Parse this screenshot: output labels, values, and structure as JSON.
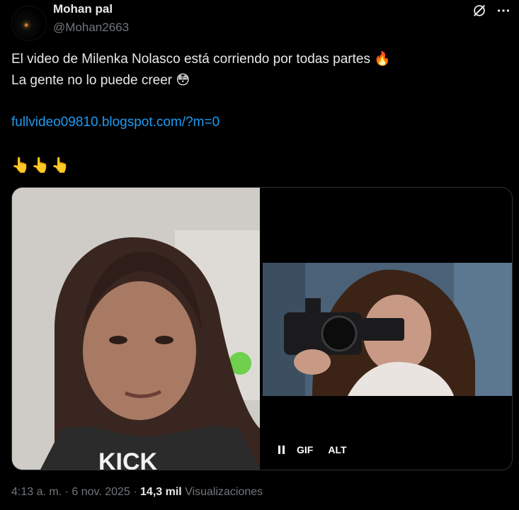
{
  "tweet": {
    "author_name": "Mohan pal",
    "author_handle": "@Mohan2663",
    "line1_text": "El video de Milenka Nolasco está corriendo por todas partes",
    "line1_emoji": "🔥",
    "line2_text": "La gente no lo puede creer",
    "line2_emoji": "😳",
    "link": "fullvideo09810.blogspot.com/?m=0",
    "emojis": "👆👆👆"
  },
  "media": {
    "left_overlay_text": "KICK",
    "gif_label": "GIF",
    "alt_label": "ALT"
  },
  "footer": {
    "time": "4:13 a. m.",
    "sep1": " · ",
    "date": "6 nov. 2025",
    "sep2": " · ",
    "views_count": "14,3 mil",
    "views_label": "Visualizaciones"
  },
  "icons": {
    "header": [
      "grok-icon",
      "more-icon"
    ],
    "media": [
      "pause-icon"
    ]
  },
  "colors": {
    "background": "#000000",
    "text": "#e7e9ea",
    "muted": "#71767b",
    "link": "#1d9bf0",
    "border": "#2f3336"
  }
}
